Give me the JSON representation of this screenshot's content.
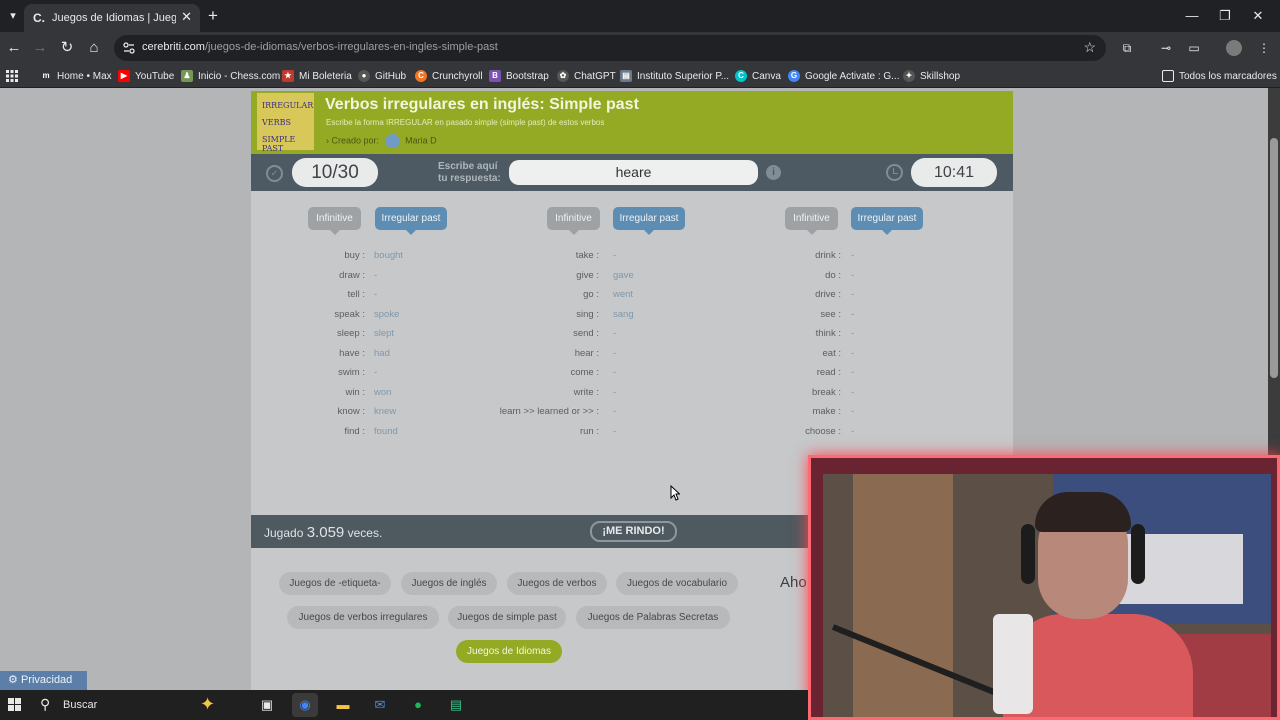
{
  "browser": {
    "tab_title": "Juegos de Idiomas | Juego de V",
    "url_host": "cerebriti.com",
    "url_path": "/juegos-de-idiomas/verbos-irregulares-en-ingles-simple-past",
    "bookmarks": [
      {
        "label": "Home • Max",
        "icon": "m",
        "color": "#35363a"
      },
      {
        "label": "YouTube",
        "icon": "▶",
        "color": "#ff0000"
      },
      {
        "label": "Inicio - Chess.com",
        "icon": "♟",
        "color": "#769656"
      },
      {
        "label": "Mi Boleteria",
        "icon": "★",
        "color": "#c0392b"
      },
      {
        "label": "GitHub",
        "icon": "●",
        "color": "#555555"
      },
      {
        "label": "Crunchyroll",
        "icon": "C",
        "color": "#f47521"
      },
      {
        "label": "Bootstrap",
        "icon": "B",
        "color": "#7952b3"
      },
      {
        "label": "ChatGPT",
        "icon": "✿",
        "color": "#555555"
      },
      {
        "label": "Instituto Superior P...",
        "icon": "▤",
        "color": "#6b7a8a"
      },
      {
        "label": "Canva",
        "icon": "C",
        "color": "#00c4cc"
      },
      {
        "label": "Google Activate : G...",
        "icon": "G",
        "color": "#4285f4"
      },
      {
        "label": "Skillshop",
        "icon": "✦",
        "color": "#555555"
      }
    ],
    "all_bookmarks": "Todos los marcadores"
  },
  "game": {
    "thumb_lines": [
      "IRREGULAR",
      "VERBS",
      "SIMPLE PAST"
    ],
    "title": "Verbos irregulares en inglés: Simple past",
    "subtitle": "Escribe la forma IRREGULAR en pasado simple (simple past) de estos verbos",
    "created_by_label": "Creado por:",
    "author": "Maria D",
    "score": "10/30",
    "prompt_line1": "Escribe aquí",
    "prompt_line2": "tu respuesta:",
    "answer_value": "heare",
    "info_label": "i",
    "timer": "10:41",
    "tag_infinitive": "Infinitive",
    "tag_past": "Irregular past",
    "columns": [
      {
        "rows": [
          {
            "inf": "buy :",
            "past": "bought"
          },
          {
            "inf": "draw :",
            "past": "-"
          },
          {
            "inf": "tell :",
            "past": "-"
          },
          {
            "inf": "speak :",
            "past": "spoke"
          },
          {
            "inf": "sleep :",
            "past": "slept"
          },
          {
            "inf": "have :",
            "past": "had"
          },
          {
            "inf": "swim :",
            "past": "-"
          },
          {
            "inf": "win :",
            "past": "won"
          },
          {
            "inf": "know :",
            "past": "knew"
          },
          {
            "inf": "find :",
            "past": "found"
          }
        ]
      },
      {
        "rows": [
          {
            "inf": "take :",
            "past": "-"
          },
          {
            "inf": "give :",
            "past": "gave"
          },
          {
            "inf": "go :",
            "past": "went"
          },
          {
            "inf": "sing :",
            "past": "sang"
          },
          {
            "inf": "send :",
            "past": "-"
          },
          {
            "inf": "hear :",
            "past": "-"
          },
          {
            "inf": "come :",
            "past": "-"
          },
          {
            "inf": "write :",
            "past": "-"
          },
          {
            "inf": "learn >> learned or >> :",
            "past": "-"
          },
          {
            "inf": "run :",
            "past": "-"
          }
        ]
      },
      {
        "rows": [
          {
            "inf": "drink :",
            "past": "-"
          },
          {
            "inf": "do :",
            "past": "-"
          },
          {
            "inf": "drive :",
            "past": "-"
          },
          {
            "inf": "see :",
            "past": "-"
          },
          {
            "inf": "think :",
            "past": "-"
          },
          {
            "inf": "eat :",
            "past": "-"
          },
          {
            "inf": "read :",
            "past": "-"
          },
          {
            "inf": "break :",
            "past": "-"
          },
          {
            "inf": "make :",
            "past": "-"
          },
          {
            "inf": "choose :",
            "past": "-"
          }
        ]
      }
    ],
    "played_prefix": "Jugado",
    "played_count": "3.059",
    "played_suffix": "veces.",
    "give_up": "¡ME RINDO!",
    "tags": [
      "Juegos de -etiqueta-",
      "Juegos de inglés",
      "Juegos de verbos",
      "Juegos de vocabulario",
      "Juegos de verbos irregulares",
      "Juegos de simple past",
      "Juegos de Palabras Secretas",
      "Juegos de Idiomas"
    ],
    "side_title": "Aho"
  },
  "privacy_label": "Privacidad",
  "taskbar": {
    "search_label": "Buscar"
  }
}
